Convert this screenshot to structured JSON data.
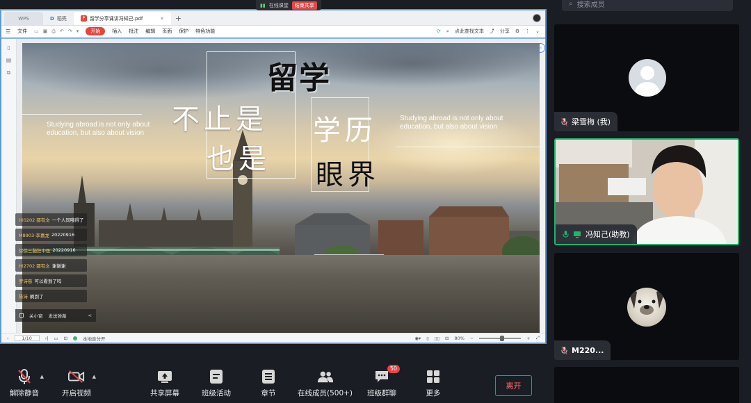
{
  "share_status": {
    "network": "在线课堂",
    "stop_label": "结束共享"
  },
  "browser": {
    "tabs": [
      {
        "label": "WPS"
      },
      {
        "label": "稻壳"
      },
      {
        "label": "留学分享课讲冯知己.pdf"
      }
    ],
    "new_tab": "+"
  },
  "menubar": {
    "items": [
      "文件",
      "开始",
      "插入",
      "批注",
      "编辑",
      "页面",
      "保护",
      "特色功能"
    ],
    "right": {
      "find": "点此查找文本",
      "share": "分享"
    }
  },
  "slide": {
    "title": "留学",
    "left_cn": [
      "不止是",
      "也是"
    ],
    "right_cn": [
      "学历",
      "眼界"
    ],
    "en_left": "Studying abroad is not only about education, but also about vision",
    "en_right": "Studying abroad is not only about education, but also about vision"
  },
  "chat": {
    "messages": [
      {
        "name": "Hi0202 邵有文",
        "text": "一个人同哦得了"
      },
      {
        "name": "M8903-李嘉龙",
        "text": "20220916"
      },
      {
        "name": "徐徐三脑狂中医",
        "text": "20220916"
      },
      {
        "name": "Hi2702 邵有文",
        "text": "谢谢谢"
      },
      {
        "name": "罗诗慈",
        "text": "可以看到了吗"
      },
      {
        "name": "陈诗",
        "text": "刷到了"
      }
    ],
    "controls": {
      "hide": "关小窗",
      "send": "发送弹幕",
      "arrow": "<"
    }
  },
  "statusbar": {
    "page": "1/10",
    "nav": "›|",
    "recording": "本地音分开",
    "zoom_label": "80%",
    "zoom_value": 0.55
  },
  "toolbar": {
    "buttons": [
      {
        "label": "解除静音"
      },
      {
        "label": "开启视频"
      },
      {
        "label": "共享屏幕"
      },
      {
        "label": "班级活动"
      },
      {
        "label": "章节"
      },
      {
        "label": "在线成员(500+)"
      },
      {
        "label": "班级群聊",
        "badge": "50"
      },
      {
        "label": "更多"
      }
    ],
    "leave": "离开"
  },
  "panel": {
    "search_placeholder": "搜索成员",
    "participants": [
      {
        "name": "梁雪梅 (我)"
      },
      {
        "name": "冯知己(助教)"
      },
      {
        "name": "M220..."
      }
    ]
  },
  "colors": {
    "accent_green": "#1fb46e",
    "danger": "#e04848",
    "wps_red": "#e3463c",
    "panel_bg": "#1b1d24"
  }
}
